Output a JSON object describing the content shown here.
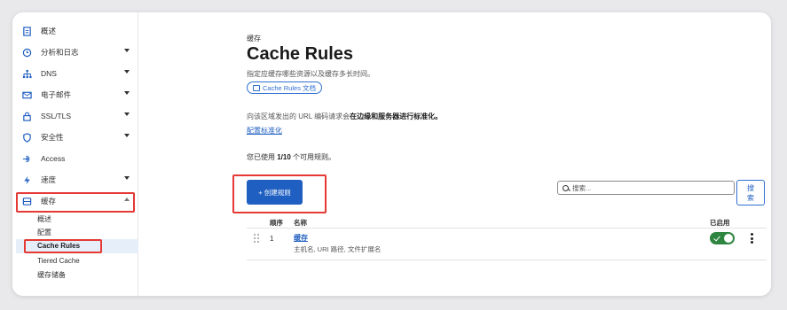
{
  "sidebar": {
    "items": [
      {
        "label": "概述",
        "icon": "document-icon",
        "has_chevron": false
      },
      {
        "label": "分析和日志",
        "icon": "clock-icon",
        "has_chevron": true
      },
      {
        "label": "DNS",
        "icon": "network-icon",
        "has_chevron": true
      },
      {
        "label": "电子邮件",
        "icon": "email-icon",
        "has_chevron": true
      },
      {
        "label": "SSL/TLS",
        "icon": "lock-icon",
        "has_chevron": true
      },
      {
        "label": "安全性",
        "icon": "shield-icon",
        "has_chevron": true
      },
      {
        "label": "Access",
        "icon": "access-icon",
        "has_chevron": false
      },
      {
        "label": "速度",
        "icon": "bolt-icon",
        "has_chevron": true
      },
      {
        "label": "缓存",
        "icon": "cache-icon",
        "has_chevron": true,
        "expanded": true
      }
    ],
    "sub_items": [
      {
        "label": "概述"
      },
      {
        "label": "配置"
      },
      {
        "label": "Cache Rules",
        "active": true
      },
      {
        "label": "Tiered Cache"
      },
      {
        "label": "缓存储备"
      }
    ]
  },
  "main": {
    "breadcrumb": "缓存",
    "title": "Cache Rules",
    "description": "指定应缓存哪些资源以及缓存多长时间。",
    "doc_button": "Cache Rules 文档",
    "normalize_text_prefix": "向该区域发出的 URL 编码请求会",
    "normalize_text_bold": "在边缘和服务器进行标准化。",
    "normalize_link": "配置标准化",
    "usage_prefix": "您已使用 ",
    "usage_count": "1/10",
    "usage_suffix": " 个可用规则。",
    "create_button": "+ 创建规则",
    "search_placeholder": "搜索...",
    "search_button": "搜索"
  },
  "table": {
    "headers": {
      "order": "顺序",
      "name": "名称",
      "enabled": "已启用"
    },
    "rows": [
      {
        "order": "1",
        "name": "缓存",
        "detail": "主机名, URI 路径, 文件扩展名",
        "enabled": true
      }
    ]
  },
  "colors": {
    "accent": "#1f5fc1",
    "toggle_on": "#2e8540",
    "highlight": "#e53935"
  }
}
